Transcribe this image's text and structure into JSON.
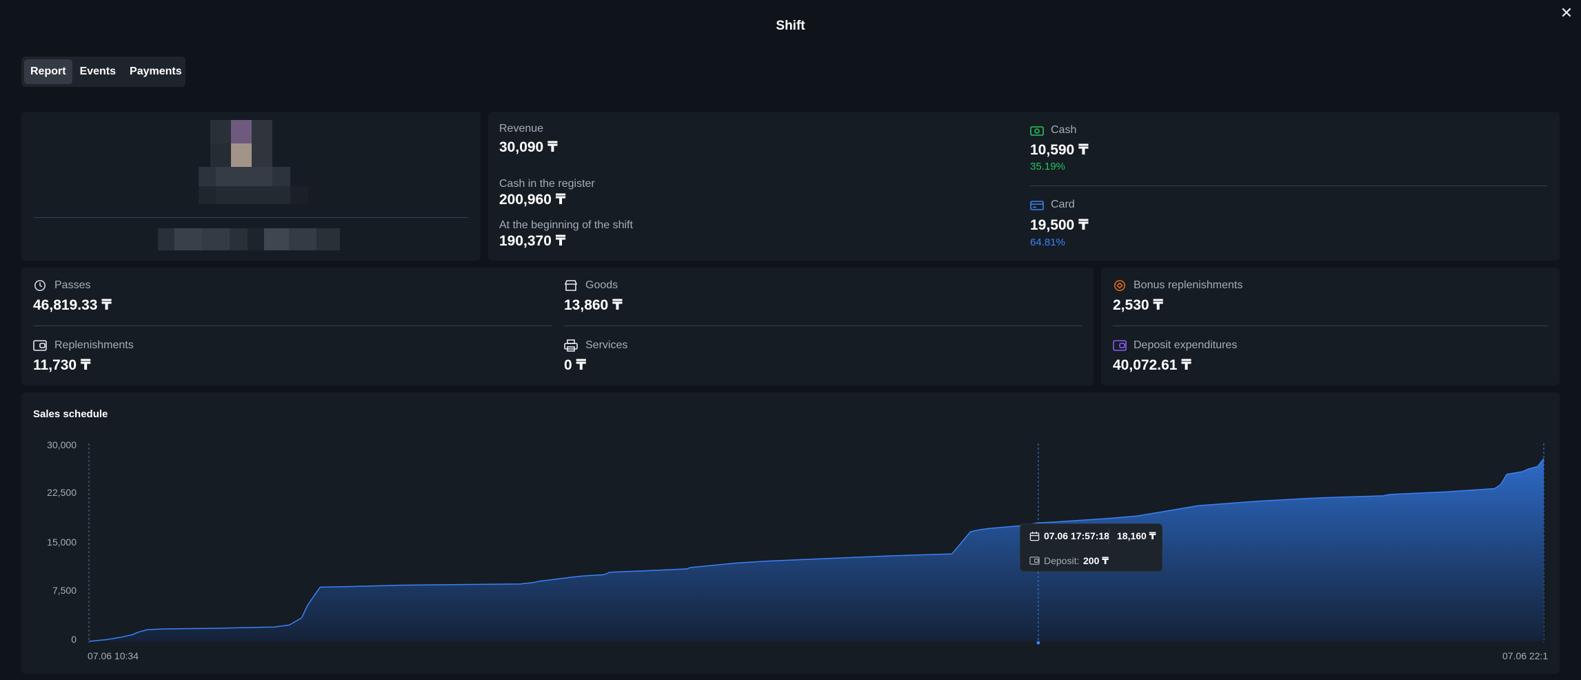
{
  "window": {
    "title": "Shift"
  },
  "tabs": [
    {
      "label": "Report",
      "active": true
    },
    {
      "label": "Events",
      "active": false
    },
    {
      "label": "Payments",
      "active": false
    }
  ],
  "summary": {
    "revenue": {
      "label": "Revenue",
      "value": "30,090 ₸"
    },
    "cash_in_register": {
      "label": "Cash in the register",
      "value": "200,960 ₸"
    },
    "beginning_of_shift": {
      "label": "At the beginning of the shift",
      "value": "190,370 ₸"
    },
    "cash": {
      "label": "Cash",
      "value": "10,590 ₸",
      "percent": "35.19%",
      "icon": "cash-icon",
      "color": "#22c55e"
    },
    "card": {
      "label": "Card",
      "value": "19,500 ₸",
      "percent": "64.81%",
      "icon": "card-icon",
      "color": "#3b82f6"
    }
  },
  "stats": {
    "passes": {
      "label": "Passes",
      "value": "46,819.33 ₸",
      "icon": "clock-icon"
    },
    "replenishments": {
      "label": "Replenishments",
      "value": "11,730 ₸",
      "icon": "wallet-icon"
    },
    "goods": {
      "label": "Goods",
      "value": "13,860 ₸",
      "icon": "store-icon"
    },
    "services": {
      "label": "Services",
      "value": "0 ₸",
      "icon": "printer-icon"
    },
    "bonus_replenishments": {
      "label": "Bonus replenishments",
      "value": "2,530 ₸",
      "icon": "bonus-icon",
      "color": "#f97316"
    },
    "deposit_expenditures": {
      "label": "Deposit expenditures",
      "value": "40,072.61 ₸",
      "icon": "deposit-wallet-icon",
      "color": "#8b5cf6"
    }
  },
  "chart_data": {
    "type": "area",
    "title": "Sales schedule",
    "x_labels": [
      "07.06 10:34",
      "07.06 22:1"
    ],
    "y_ticks": [
      "30,000",
      "22,500",
      "15,000",
      "7,500",
      "0"
    ],
    "ylim": [
      0,
      30000
    ],
    "x_hours": [
      0,
      0.3,
      0.5,
      0.7,
      0.8,
      0.95,
      1.2,
      2.0,
      3.0,
      3.25,
      3.45,
      3.55,
      3.75,
      4.25,
      5.0,
      6.0,
      7.0,
      7.1,
      7.2,
      7.3,
      7.8,
      8.0,
      8.15,
      8.35,
      8.45,
      9.0,
      9.7,
      9.75,
      10.5,
      11.0,
      12.0,
      13.0,
      14.0,
      14.3,
      14.35,
      14.45,
      14.6,
      15.1,
      15.4,
      15.7,
      16.0,
      16.5,
      17.0,
      17.5,
      18.0,
      19.0,
      20.0,
      21.0,
      21.1,
      21.3,
      22.0,
      22.8,
      22.9,
      23.0,
      23.25,
      23.35,
      23.5,
      23.6
    ],
    "y_values": [
      0,
      300,
      600,
      1000,
      1400,
      1800,
      1900,
      2000,
      2200,
      2500,
      3600,
      5600,
      8300,
      8400,
      8600,
      8700,
      8800,
      8900,
      9000,
      9200,
      9800,
      10000,
      10100,
      10200,
      10600,
      10800,
      11100,
      11300,
      12000,
      12300,
      12700,
      13100,
      13400,
      16800,
      16900,
      17100,
      17300,
      17700,
      18160,
      18300,
      18500,
      18800,
      19200,
      20000,
      20800,
      21500,
      22000,
      22300,
      22500,
      22600,
      22900,
      23400,
      24000,
      25600,
      26000,
      26400,
      26800,
      28000
    ],
    "series_color": "#3b82f6",
    "grid": false
  },
  "tooltip": {
    "datetime": "07.06 17:57:18",
    "total": "18,160 ₸",
    "deposit_label": "Deposit:",
    "deposit_value": "200 ₸",
    "x_hours": 15.4
  }
}
